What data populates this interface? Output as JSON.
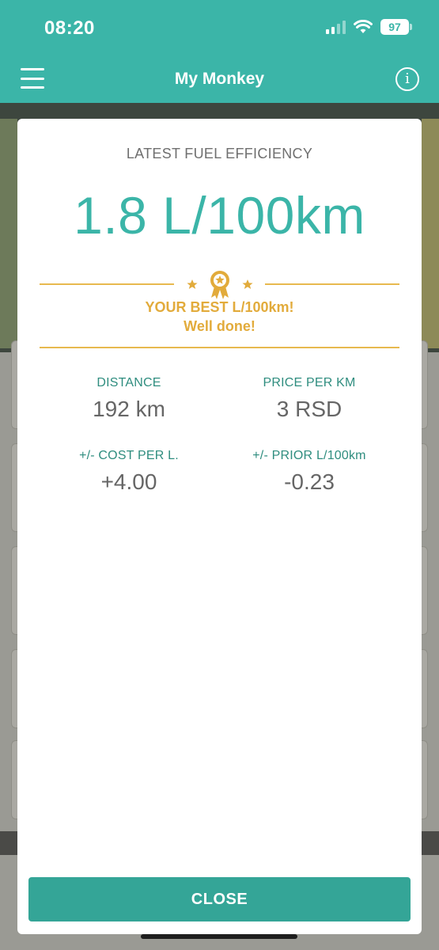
{
  "status": {
    "time": "08:20",
    "battery": "97"
  },
  "app": {
    "title": "My Monkey"
  },
  "modal": {
    "header": "LATEST FUEL EFFICIENCY",
    "value": "1.8 L/100km",
    "best_line1": "YOUR BEST L/100km!",
    "best_line2": "Well done!",
    "stats": [
      {
        "label": "DISTANCE",
        "value": "192 km"
      },
      {
        "label": "PRICE PER KM",
        "value": "3 RSD"
      },
      {
        "label": "+/- COST PER L.",
        "value": "+4.00"
      },
      {
        "label": "+/- PRIOR L/100km",
        "value": "-0.23"
      }
    ],
    "close_label": "CLOSE"
  },
  "colors": {
    "accent": "#3bb5a8",
    "gold": "#e2ab3b",
    "button": "#34a597"
  },
  "icons": [
    "menu-icon",
    "info-icon",
    "award-ribbon-icon",
    "star-icon",
    "wifi-icon",
    "signal-icon",
    "battery-icon"
  ]
}
